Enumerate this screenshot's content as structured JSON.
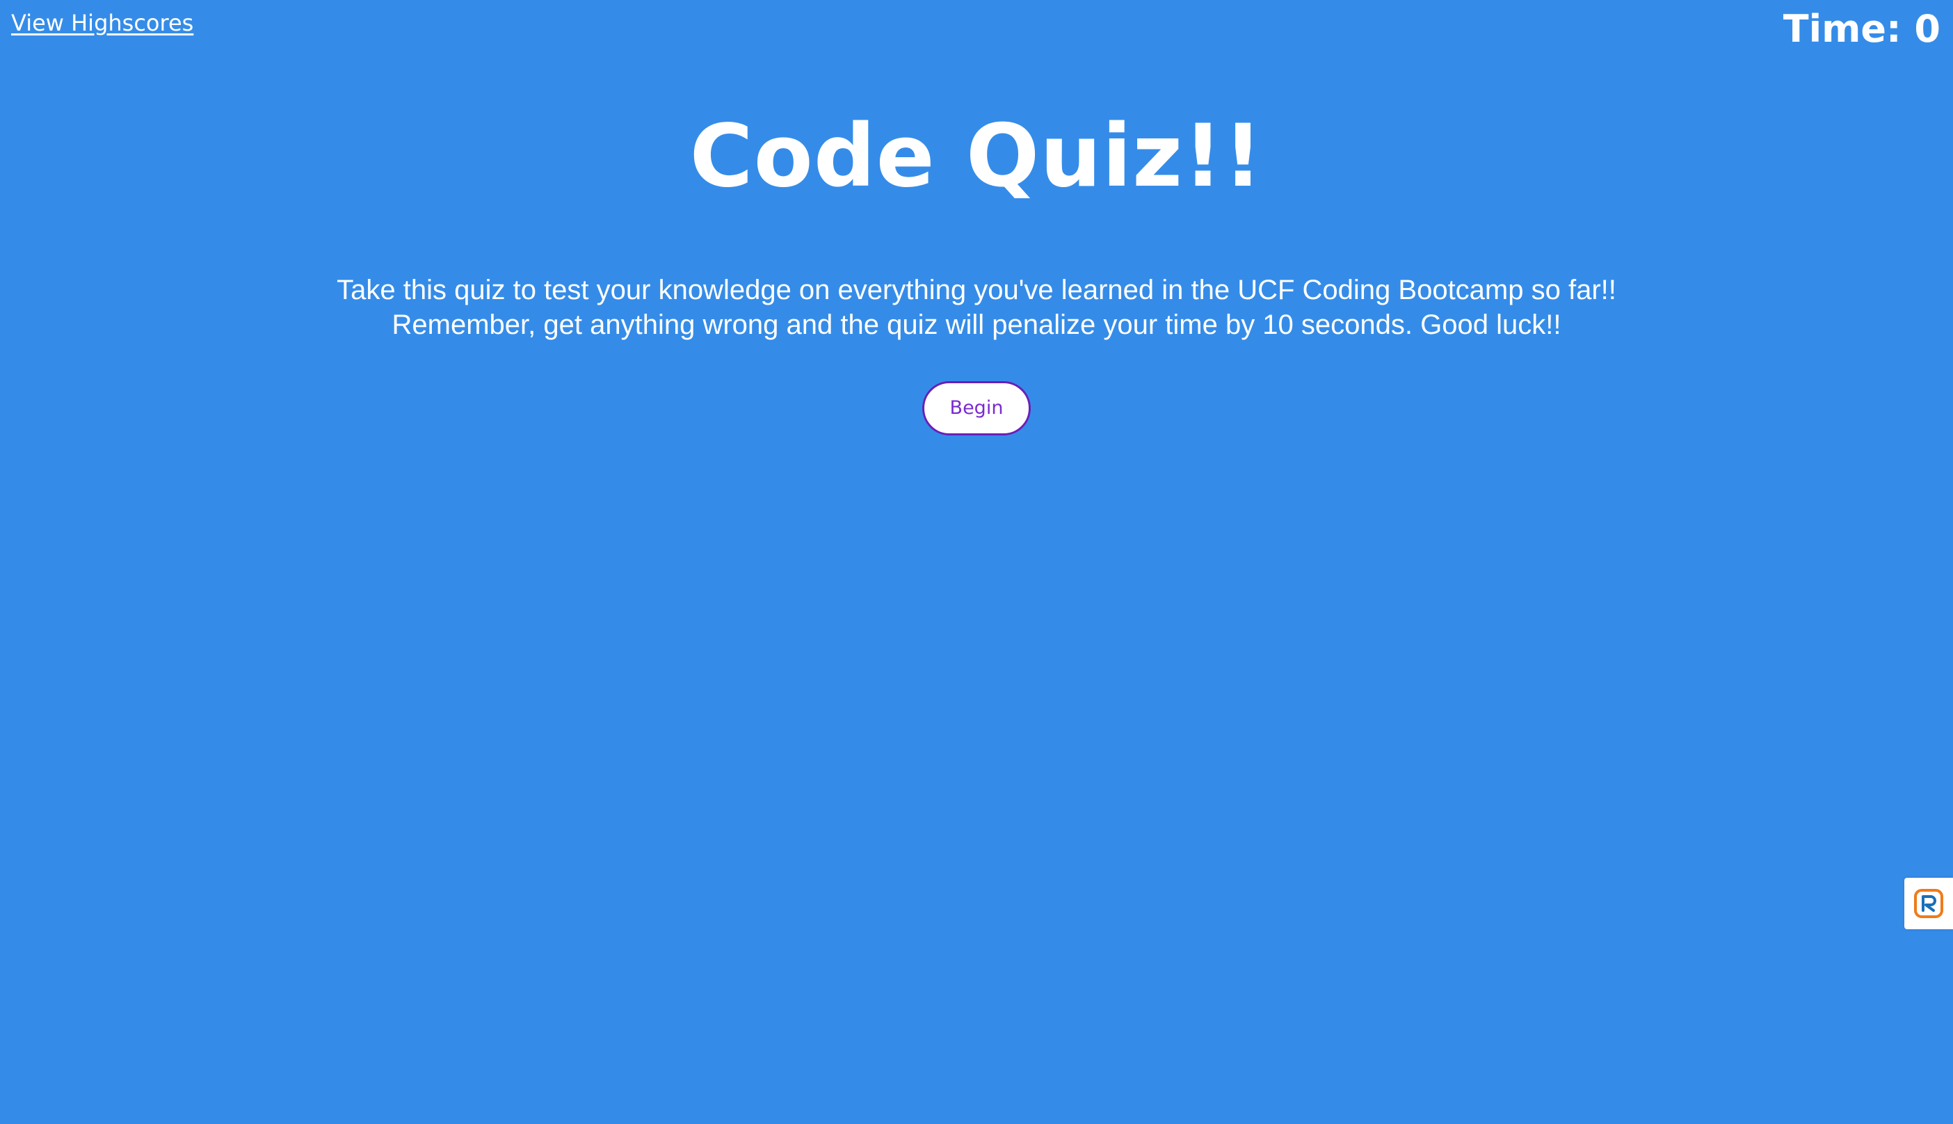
{
  "header": {
    "highscores_link": "View Highscores",
    "timer_label": "Time: 0"
  },
  "main": {
    "title": "Code Quiz!!",
    "intro_line1": "Take this quiz to test your knowledge on everything you've learned in the UCF Coding Bootcamp so far!!",
    "intro_line2": "Remember, get anything wrong and the quiz will penalize your time by 10 seconds. Good luck!!",
    "begin_label": "Begin"
  },
  "side_widget": {
    "icon": "r-logo-icon"
  },
  "colors": {
    "background": "#358CE8",
    "text": "#FFFFFF",
    "button_text": "#7A2BD0",
    "button_border": "#6A1FB8",
    "widget_orange": "#F07B1A",
    "widget_blue": "#1A6FB8"
  }
}
